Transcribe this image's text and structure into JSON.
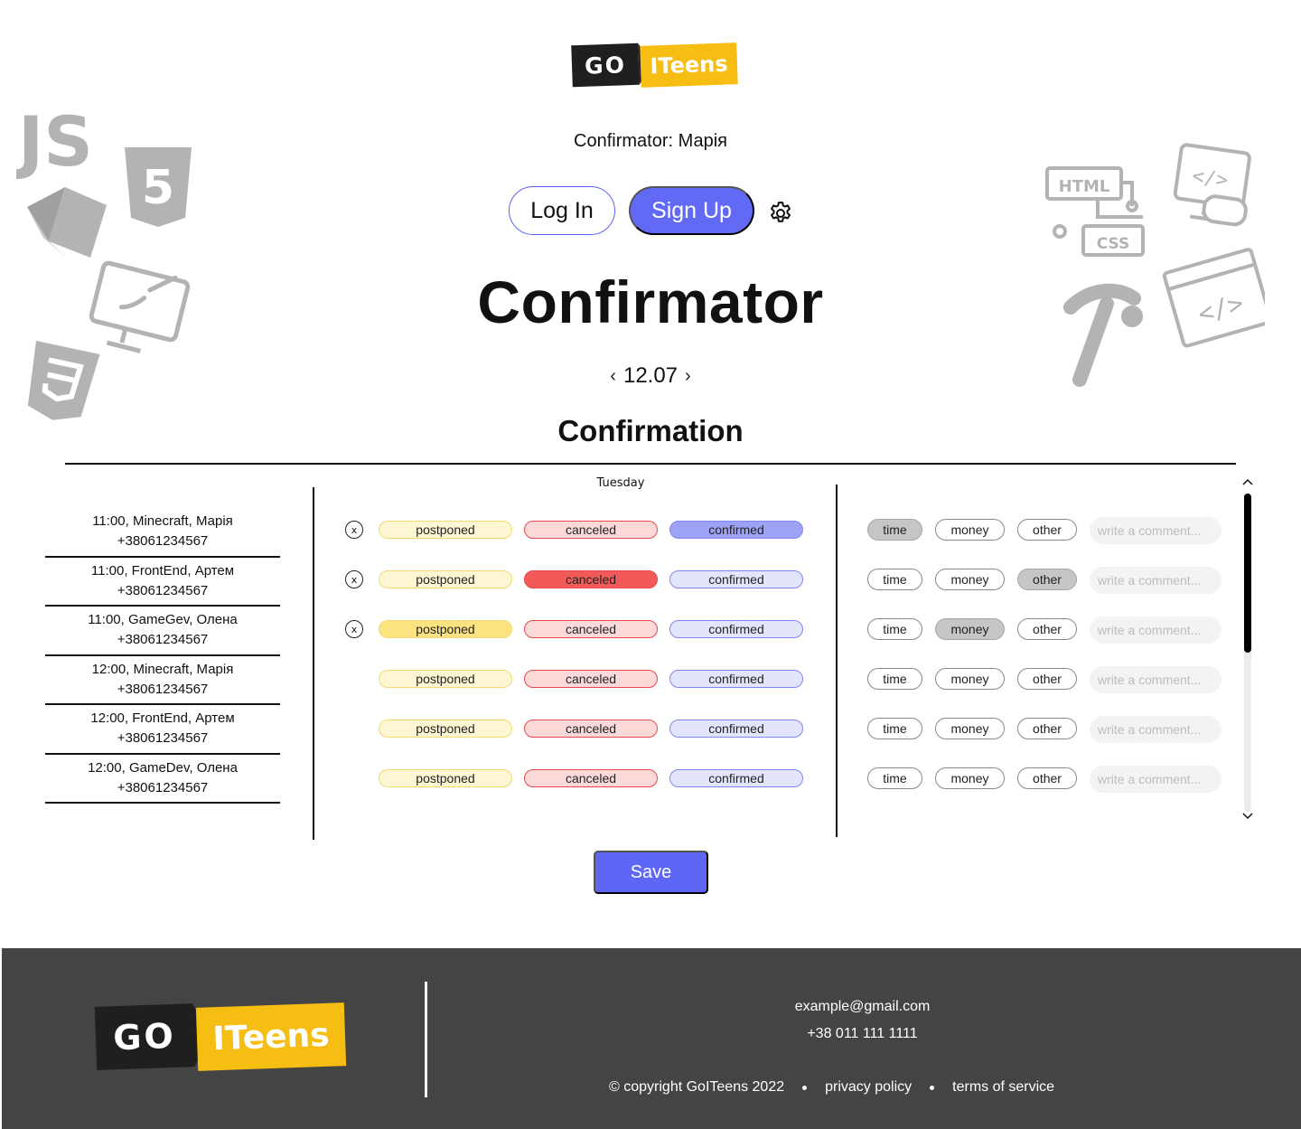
{
  "brand": {
    "go": "GO",
    "iteens": "ITeens"
  },
  "header": {
    "subtitle": "Confirmator: Марія",
    "login_label": "Log In",
    "signup_label": "Sign Up"
  },
  "page_title": "Confirmator",
  "date_nav": {
    "prev": "‹",
    "date": "12.07",
    "next": "›"
  },
  "section_title": "Confirmation",
  "day_label": "Tuesday",
  "lessons": [
    {
      "line1": "11:00, Minecraft, Марія",
      "line2": "+38061234567",
      "removable": true,
      "status": "confirmed",
      "reason": "time",
      "comment": ""
    },
    {
      "line1": "11:00, FrontEnd, Артем",
      "line2": "+38061234567",
      "removable": true,
      "status": "canceled",
      "reason": "other",
      "comment": ""
    },
    {
      "line1": "11:00, GameGev, Олена",
      "line2": "+38061234567",
      "removable": true,
      "status": "postponed",
      "reason": "money",
      "comment": ""
    },
    {
      "line1": "12:00, Minecraft, Марія",
      "line2": "+38061234567",
      "removable": false,
      "status": "",
      "reason": "",
      "comment": ""
    },
    {
      "line1": "12:00, FrontEnd, Артем",
      "line2": "+38061234567",
      "removable": false,
      "status": "",
      "reason": "",
      "comment": ""
    },
    {
      "line1": "12:00, GameDev, Олена",
      "line2": "+38061234567",
      "removable": false,
      "status": "",
      "reason": "",
      "comment": ""
    }
  ],
  "status_labels": {
    "remove": "x",
    "postponed": "postponed",
    "canceled": "canceled",
    "confirmed": "confirmed"
  },
  "reason_labels": {
    "time": "time",
    "money": "money",
    "other": "other"
  },
  "comment_placeholder": "write a comment...",
  "save_label": "Save",
  "footer": {
    "email": "example@gmail.com",
    "phone": "+38 011 111 1111",
    "copyright": "© copyright GoITeens 2022",
    "privacy": "privacy policy",
    "terms": "terms of service"
  },
  "colors": {
    "accent": "#6169f5",
    "brand_yellow": "#f6bd12",
    "brand_dark": "#1f1f1f",
    "footer_bg": "#444444",
    "postponed_active": "#fce382",
    "canceled_active": "#f25a5a",
    "confirmed_active": "#9da2f5"
  },
  "icons": {
    "settings": "gear-icon",
    "remove": "close-circle-icon",
    "scroll_up": "chevron-up-icon",
    "scroll_down": "chevron-down-icon"
  }
}
